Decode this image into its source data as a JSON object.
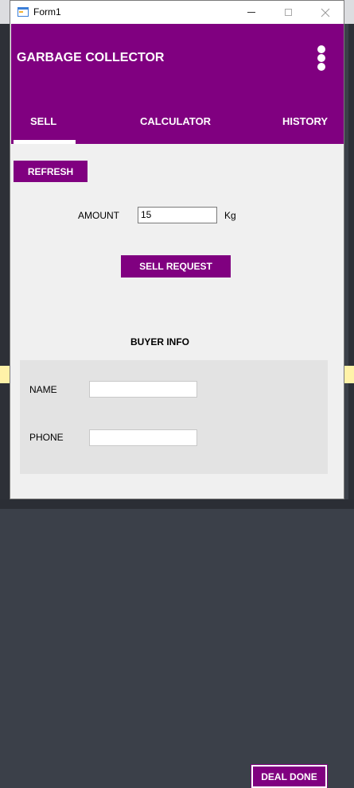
{
  "window": {
    "title": "Form1"
  },
  "header": {
    "app_title": "GARBAGE COLLECTOR",
    "tabs": [
      {
        "label": "SELL",
        "selected": true
      },
      {
        "label": "CALCULATOR",
        "selected": false
      },
      {
        "label": "HISTORY",
        "selected": false
      }
    ]
  },
  "sell": {
    "refresh_label": "REFRESH",
    "amount_label": "AMOUNT",
    "amount_value": "15",
    "unit_label": "Kg",
    "sell_request_label": "SELL REQUEST"
  },
  "buyer": {
    "title": "BUYER INFO",
    "name_label": "NAME",
    "name_value": "",
    "phone_label": "PHONE",
    "phone_value": "",
    "deal_done_label": "DEAL DONE"
  },
  "colors": {
    "accent": "#800080",
    "background": "#f0f0f0",
    "panel": "#e3e3e3"
  },
  "icons": [
    "app-icon",
    "minimize-icon",
    "maximize-icon",
    "close-icon",
    "more-vertical-icon"
  ]
}
